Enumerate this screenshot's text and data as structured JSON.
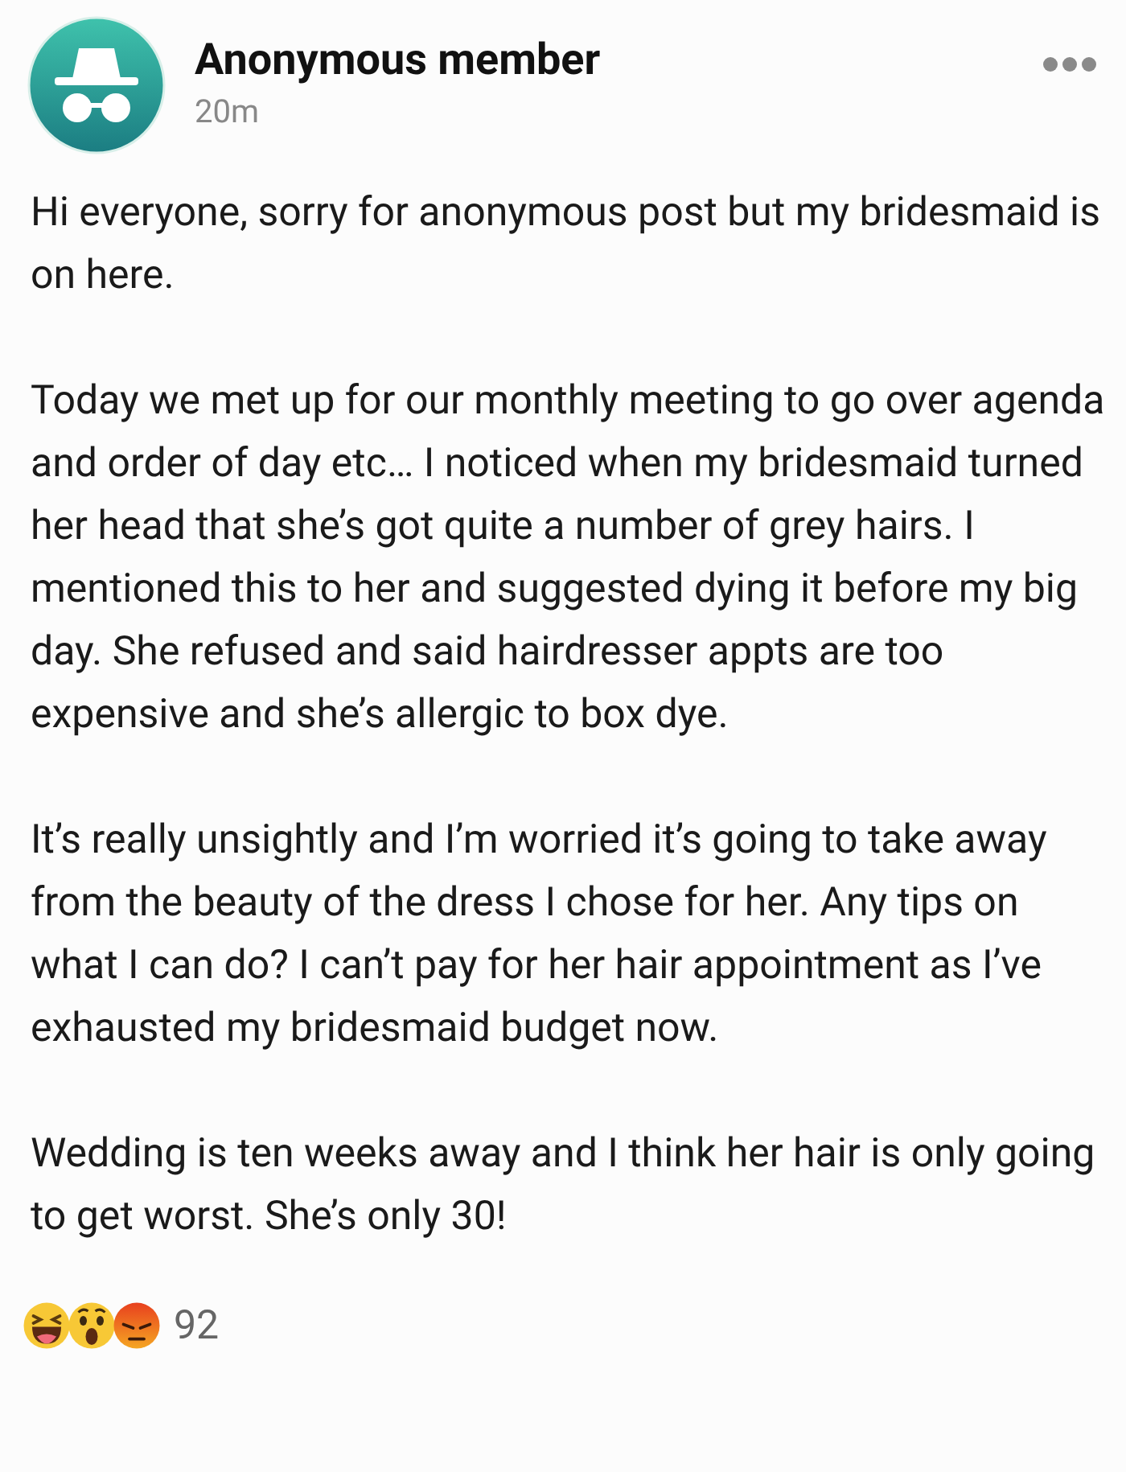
{
  "post": {
    "author": "Anonymous member",
    "time": "20m",
    "paragraphs": [
      "Hi everyone, sorry for anonymous post but my bridesmaid is on here.",
      "Today we met up for our monthly meeting to go over agenda and order of day etc… I noticed when my bridesmaid turned her head that she’s got quite a number of grey hairs. I mentioned this to her and suggested dying it before my big day. She refused and said hairdresser appts are too expensive and she’s allergic to box dye.",
      "It’s really unsightly and I’m worried it’s going to take away from the beauty of the dress I chose for her. Any tips on what I can do? I can’t pay for her hair appointment as I’ve exhausted my bridesmaid budget now.",
      "Wedding is ten weeks away and I think her hair is only going to get worst. She’s only 30!"
    ],
    "reactions": [
      {
        "kind": "haha"
      },
      {
        "kind": "wow"
      },
      {
        "kind": "angry"
      }
    ],
    "reaction_count": "92"
  }
}
